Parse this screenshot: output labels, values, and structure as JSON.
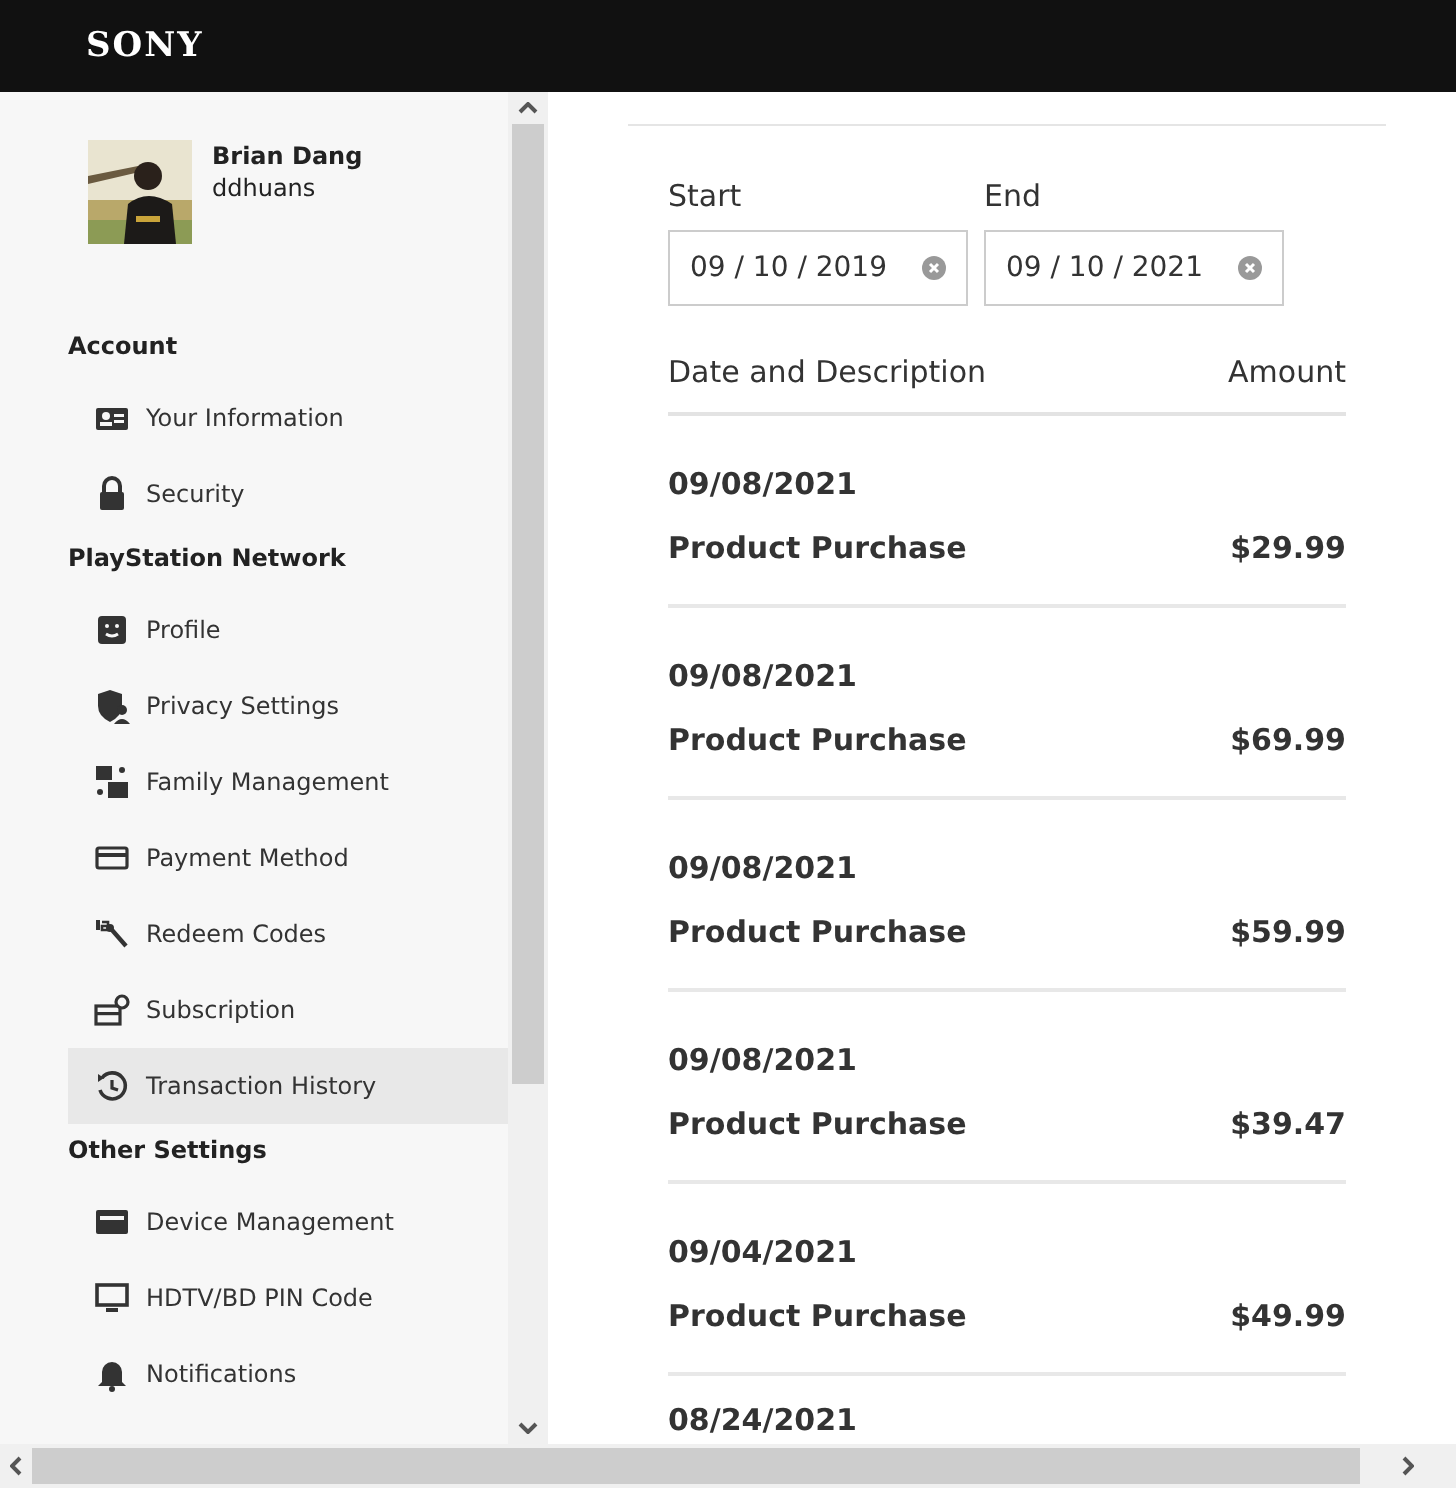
{
  "header": {
    "logo": "SONY"
  },
  "profile": {
    "name": "Brian Dang",
    "username": "ddhuans"
  },
  "sidebar": {
    "sections": [
      {
        "title": "Account",
        "items": [
          {
            "label": "Your Information",
            "selected": false
          },
          {
            "label": "Security",
            "selected": false
          }
        ]
      },
      {
        "title": "PlayStation Network",
        "items": [
          {
            "label": "Profile",
            "selected": false
          },
          {
            "label": "Privacy Settings",
            "selected": false
          },
          {
            "label": "Family Management",
            "selected": false
          },
          {
            "label": "Payment Method",
            "selected": false
          },
          {
            "label": "Redeem Codes",
            "selected": false
          },
          {
            "label": "Subscription",
            "selected": false
          },
          {
            "label": "Transaction History",
            "selected": true
          }
        ]
      },
      {
        "title": "Other Settings",
        "items": [
          {
            "label": "Device Management",
            "selected": false
          },
          {
            "label": "HDTV/BD PIN Code",
            "selected": false
          },
          {
            "label": "Notifications",
            "selected": false
          }
        ]
      }
    ]
  },
  "filters": [
    {
      "label": "Start",
      "value": "09 / 10 / 2019"
    },
    {
      "label": "End",
      "value": "09 / 10 / 2021"
    }
  ],
  "table": {
    "columns": [
      "Date and Description",
      "Amount"
    ],
    "rows": [
      {
        "date": "09/08/2021",
        "description": "Product Purchase",
        "amount": "$29.99"
      },
      {
        "date": "09/08/2021",
        "description": "Product Purchase",
        "amount": "$69.99"
      },
      {
        "date": "09/08/2021",
        "description": "Product Purchase",
        "amount": "$59.99"
      },
      {
        "date": "09/08/2021",
        "description": "Product Purchase",
        "amount": "$39.47"
      },
      {
        "date": "09/04/2021",
        "description": "Product Purchase",
        "amount": "$49.99"
      },
      {
        "date": "08/24/2021"
      }
    ]
  }
}
